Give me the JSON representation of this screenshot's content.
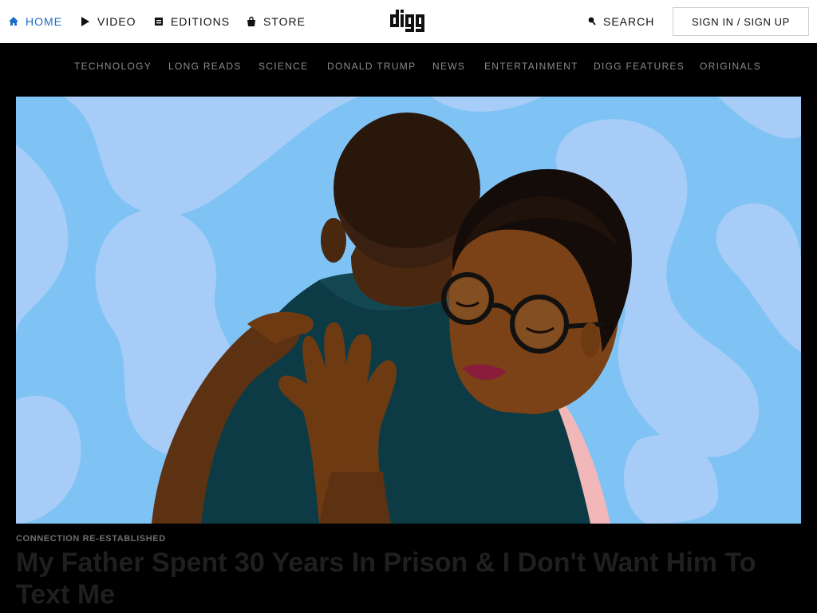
{
  "header": {
    "nav": [
      {
        "label": "HOME",
        "icon": "home-icon",
        "active": true
      },
      {
        "label": "VIDEO",
        "icon": "play-icon",
        "active": false
      },
      {
        "label": "EDITIONS",
        "icon": "editions-icon",
        "active": false
      },
      {
        "label": "STORE",
        "icon": "shopping-bag-icon",
        "active": false
      }
    ],
    "logo_text": "digg",
    "search_label": "SEARCH",
    "signin_label": "SIGN IN / SIGN UP",
    "active_color": "#1a6cc6"
  },
  "categories": [
    "TECHNOLOGY",
    "LONG READS",
    "SCIENCE",
    "DONALD TRUMP",
    "NEWS",
    "ENTERTAINMENT",
    "DIGG FEATURES",
    "ORIGINALS"
  ],
  "feature": {
    "kicker": "CONNECTION RE-ESTABLISHED",
    "headline": "My Father Spent 30 Years In Prison & I Don't Want Him To Text Me",
    "colors": {
      "sky": "#7fc3f5",
      "cloud": "#a7ccf7",
      "shirt": "#0d3b45",
      "skin": "#6e3a12",
      "hair": "#140c08"
    }
  }
}
